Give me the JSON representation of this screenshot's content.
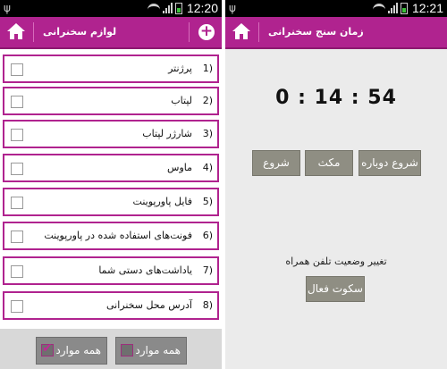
{
  "left_screen": {
    "status_time": "12:20",
    "title": "لوازم سخنرانی",
    "items": [
      {
        "num": "1)",
        "label": "پرژنتر"
      },
      {
        "num": "2)",
        "label": "لپتاب"
      },
      {
        "num": "3)",
        "label": "شارژر لپتاب"
      },
      {
        "num": "4)",
        "label": "ماوس"
      },
      {
        "num": "5)",
        "label": "فایل پاورپوینت"
      },
      {
        "num": "6)",
        "label": "فونت‌های استفاده شده در پاورپوینت"
      },
      {
        "num": "7)",
        "label": "یاداشت‌های دستی شما"
      },
      {
        "num": "8)",
        "label": "آدرس محل سخنرانی"
      }
    ],
    "select_all_label": "همه موارد",
    "deselect_all_label": "همه موارد"
  },
  "right_screen": {
    "status_time": "12:21",
    "title": "زمان سنج سخنرانی",
    "timer": "0 : 14 : 54",
    "restart_label": "شروع دوباره",
    "pause_label": "مکث",
    "start_label": "شروع",
    "phone_status_label": "تغییر وضعیت تلفن همراه",
    "silent_active_label": "سکوت فعال"
  },
  "colors": {
    "accent": "#b0238f",
    "button_gray": "#8f8e83"
  }
}
